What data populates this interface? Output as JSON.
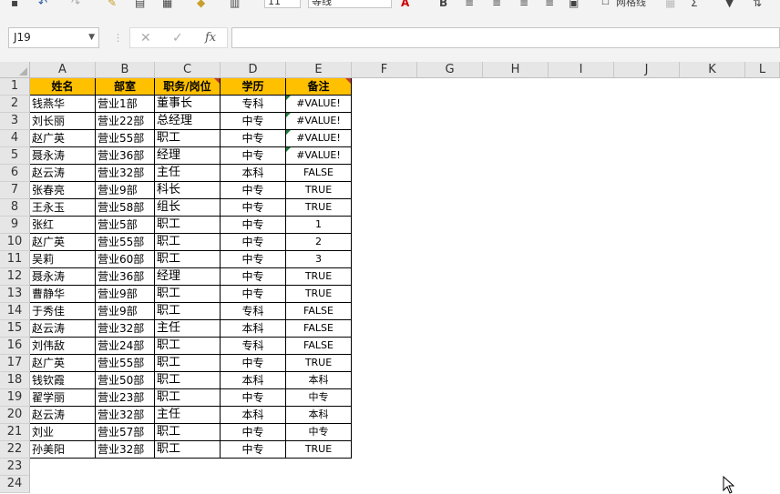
{
  "toolbar": {
    "font_size": "11",
    "font_name": "等线",
    "gridlines_label": "网格线"
  },
  "formula_bar": {
    "name_box": "J19",
    "fx": "fx",
    "cancel": "✕",
    "enter": "✓",
    "content": ""
  },
  "columns": [
    "A",
    "B",
    "C",
    "D",
    "E",
    "F",
    "G",
    "H",
    "I",
    "J",
    "K",
    "L"
  ],
  "rows": [
    "1",
    "2",
    "3",
    "4",
    "5",
    "6",
    "7",
    "8",
    "9",
    "10",
    "11",
    "12",
    "13",
    "14",
    "15",
    "16",
    "17",
    "18",
    "19",
    "20",
    "21",
    "22",
    "23",
    "24"
  ],
  "table": {
    "headers": [
      "姓名",
      "部室",
      "职务/岗位",
      "学历",
      "备注"
    ],
    "data": [
      [
        "钱燕华",
        "营业1部",
        "董事长",
        "专科",
        "#VALUE!"
      ],
      [
        "刘长丽",
        "营业22部",
        "总经理",
        "中专",
        "#VALUE!"
      ],
      [
        "赵广英",
        "营业55部",
        "职工",
        "中专",
        "#VALUE!"
      ],
      [
        "聂永涛",
        "营业36部",
        "经理",
        "中专",
        "#VALUE!"
      ],
      [
        "赵云涛",
        "营业32部",
        "主任",
        "本科",
        "FALSE"
      ],
      [
        "张春亮",
        "营业9部",
        "科长",
        "中专",
        "TRUE"
      ],
      [
        "王永玉",
        "营业58部",
        "组长",
        "中专",
        "TRUE"
      ],
      [
        "张红",
        "营业5部",
        "职工",
        "中专",
        "1"
      ],
      [
        "赵广英",
        "营业55部",
        "职工",
        "中专",
        "2"
      ],
      [
        "吴莉",
        "营业60部",
        "职工",
        "中专",
        "3"
      ],
      [
        "聂永涛",
        "营业36部",
        "经理",
        "中专",
        "TRUE"
      ],
      [
        "曹静华",
        "营业9部",
        "职工",
        "中专",
        "TRUE"
      ],
      [
        "于秀佳",
        "营业9部",
        "职工",
        "专科",
        "FALSE"
      ],
      [
        "赵云涛",
        "营业32部",
        "主任",
        "本科",
        "FALSE"
      ],
      [
        "刘伟敌",
        "营业24部",
        "职工",
        "专科",
        "FALSE"
      ],
      [
        "赵广英",
        "营业55部",
        "职工",
        "中专",
        "TRUE"
      ],
      [
        "钱钦霞",
        "营业50部",
        "职工",
        "本科",
        "本科"
      ],
      [
        "翟学丽",
        "营业23部",
        "职工",
        "中专",
        "中专"
      ],
      [
        "赵云涛",
        "营业32部",
        "主任",
        "本科",
        "本科"
      ],
      [
        "刘业",
        "营业57部",
        "职工",
        "中专",
        "中专"
      ],
      [
        "孙美阳",
        "营业32部",
        "职工",
        "中专",
        "TRUE"
      ]
    ]
  },
  "colors": {
    "header_fill": "#ffc000",
    "error_indicator": "#1b7b3c",
    "comment_indicator": "#c0392b"
  }
}
